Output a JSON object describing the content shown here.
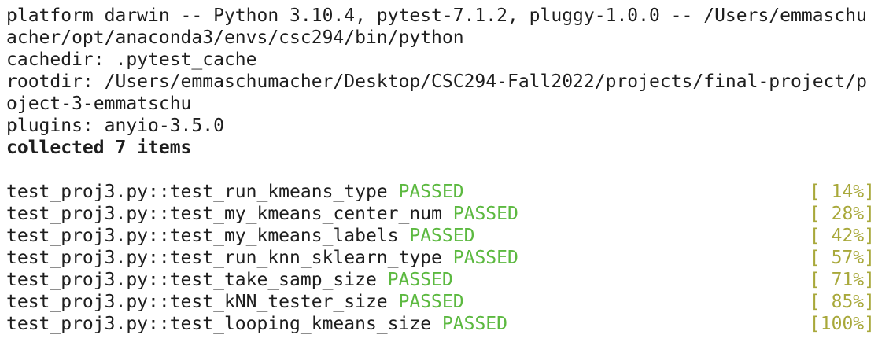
{
  "header": {
    "platform": "platform darwin -- Python 3.10.4, pytest-7.1.2, pluggy-1.0.0 -- /Users/emmaschu",
    "platform_wrap": "acher/opt/anaconda3/envs/csc294/bin/python",
    "cachedir": "cachedir: .pytest_cache",
    "rootdir": "rootdir: /Users/emmaschumacher/Desktop/CSC294-Fall2022/projects/final-project/p",
    "rootdir_wrap": "oject-3-emmatschu",
    "plugins": "plugins: anyio-3.5.0",
    "collected": "collected 7 items"
  },
  "colors": {
    "passed": "#5cb940",
    "percent": "#a8a83a",
    "text": "#1e1e1e"
  },
  "tests": [
    {
      "name": "test_proj3.py::test_run_kmeans_type",
      "status": "PASSED",
      "percent": "[ 14%]"
    },
    {
      "name": "test_proj3.py::test_my_kmeans_center_num",
      "status": "PASSED",
      "percent": "[ 28%]"
    },
    {
      "name": "test_proj3.py::test_my_kmeans_labels",
      "status": "PASSED",
      "percent": "[ 42%]"
    },
    {
      "name": "test_proj3.py::test_run_knn_sklearn_type",
      "status": "PASSED",
      "percent": "[ 57%]"
    },
    {
      "name": "test_proj3.py::test_take_samp_size",
      "status": "PASSED",
      "percent": "[ 71%]"
    },
    {
      "name": "test_proj3.py::test_kNN_tester_size",
      "status": "PASSED",
      "percent": "[ 85%]"
    },
    {
      "name": "test_proj3.py::test_looping_kmeans_size",
      "status": "PASSED",
      "percent": "[100%]"
    }
  ]
}
